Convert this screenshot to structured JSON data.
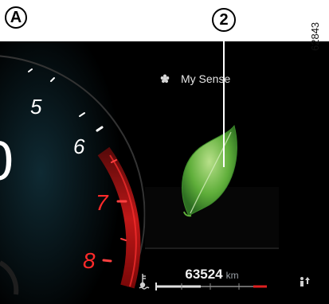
{
  "callouts": {
    "a": "A",
    "two": "2"
  },
  "reference_code": "62843",
  "tachometer": {
    "scale_labels": [
      "5",
      "6",
      "7",
      "8"
    ],
    "partial_digit": "0"
  },
  "drive_mode": {
    "icon": "flower-icon",
    "label": "My Sense"
  },
  "odometer": {
    "value": "63524",
    "unit": "km"
  },
  "status_icons": {
    "coolant": "coolant-temperature-icon",
    "gear_shift": "gear-shift-indicator-icon"
  },
  "colors": {
    "background": "#000000",
    "redline": "#e02020",
    "scale_white": "#ffffff",
    "leaf_green": "#7dc242"
  }
}
